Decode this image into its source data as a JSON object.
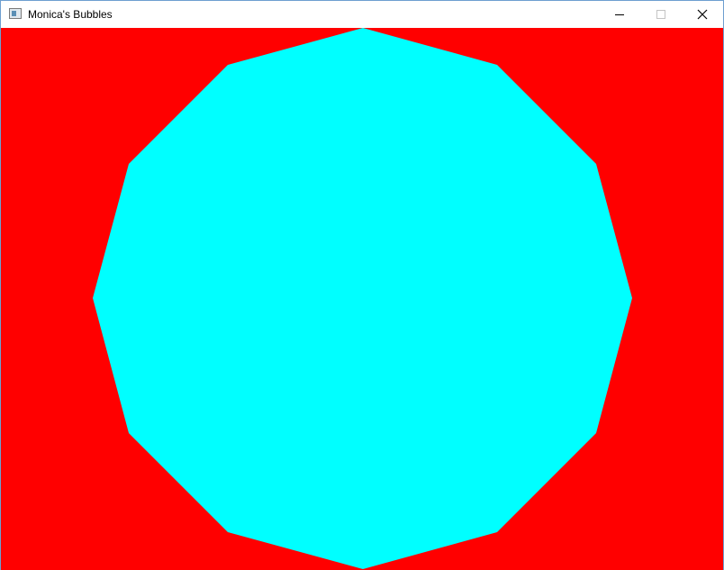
{
  "window": {
    "title": "Monica's Bubbles",
    "controls": {
      "minimize_icon": "minimize-icon",
      "maximize_icon": "maximize-icon",
      "close_icon": "close-icon"
    }
  },
  "canvas": {
    "background_color": "#ff0000",
    "shape": {
      "kind": "dodecagon",
      "sides": 12,
      "fill_color": "#00ffff"
    }
  }
}
